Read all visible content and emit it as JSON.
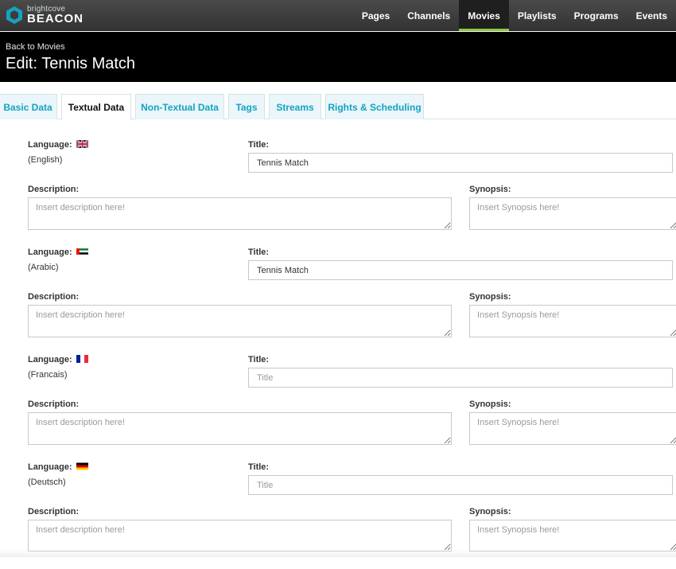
{
  "app": {
    "logo_small": "brightcove",
    "logo_big": "BEACON"
  },
  "nav": {
    "items": [
      {
        "label": "Pages",
        "active": false
      },
      {
        "label": "Channels",
        "active": false
      },
      {
        "label": "Movies",
        "active": true
      },
      {
        "label": "Playlists",
        "active": false
      },
      {
        "label": "Programs",
        "active": false
      },
      {
        "label": "Events",
        "active": false
      }
    ]
  },
  "header": {
    "back_link": "Back to Movies",
    "title": "Edit: Tennis Match"
  },
  "tabs": [
    {
      "label": "Basic Data",
      "active": false
    },
    {
      "label": "Textual Data",
      "active": true
    },
    {
      "label": "Non-Textual Data",
      "active": false
    },
    {
      "label": "Tags",
      "active": false
    },
    {
      "label": "Streams",
      "active": false
    },
    {
      "label": "Rights & Scheduling",
      "active": false
    }
  ],
  "labels": {
    "language": "Language:",
    "title": "Title:",
    "description": "Description:",
    "synopsis": "Synopsis:"
  },
  "languages": [
    {
      "name": "(English)",
      "flag": "uk-flag-icon",
      "title_value": "Tennis Match",
      "title_placeholder": "Title",
      "description_placeholder": "Insert description here!",
      "synopsis_placeholder": "Insert Synopsis here!"
    },
    {
      "name": "(Arabic)",
      "flag": "uae-flag-icon",
      "title_value": "Tennis Match",
      "title_placeholder": "Title",
      "description_placeholder": "Insert description here!",
      "synopsis_placeholder": "Insert Synopsis here!"
    },
    {
      "name": "(Francais)",
      "flag": "france-flag-icon",
      "title_value": "",
      "title_placeholder": "Title",
      "description_placeholder": "Insert description here!",
      "synopsis_placeholder": "Insert Synopsis here!"
    },
    {
      "name": "(Deutsch)",
      "flag": "germany-flag-icon",
      "title_value": "",
      "title_placeholder": "Title",
      "description_placeholder": "Insert description here!",
      "synopsis_placeholder": "Insert Synopsis here!"
    }
  ],
  "colors": {
    "nav_active_underline": "#8cc63f",
    "tab_text": "#16a2c0",
    "tab_bg": "#eaf6fa"
  }
}
